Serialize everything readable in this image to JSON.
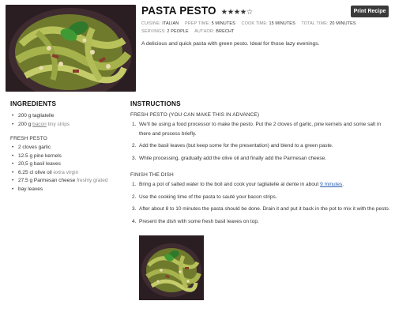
{
  "recipe": {
    "title": "PASTA PESTO",
    "stars": "★★★★☆",
    "print_label": "Print Recipe",
    "meta": {
      "cuisine_label": "CUISINE:",
      "cuisine": "ITALIAN",
      "prep_label": "PREP TIME:",
      "prep": "5 MINUTES",
      "cook_label": "COOK TIME:",
      "cook": "15 MINUTES",
      "total_label": "TOTAL TIME:",
      "total": "20 MINUTES",
      "servings_label": "SERVINGS:",
      "servings": "2 PEOPLE",
      "author_label": "AUTHOR:",
      "author": "BRECHT"
    },
    "description": "A delicious and quick pasta with green pesto. Ideal for those lazy evenings.",
    "hero_image": "pasta-pesto-photo",
    "dish_image": "pasta-pesto-photo"
  },
  "ingredients": {
    "heading": "INGREDIENTS",
    "main": [
      {
        "text": "200 g tagliatelle"
      },
      {
        "pre": "200 g ",
        "link": "bacon",
        "note": " tiny strips"
      }
    ],
    "pesto_heading": "FRESH PESTO",
    "pesto": [
      {
        "text": "2 cloves garlic"
      },
      {
        "text": "12.5 g pine kernels"
      },
      {
        "text": "20,5 g basil leaves"
      },
      {
        "pre": "6.25 cl olive oil",
        "note": " extra virgin"
      },
      {
        "pre": "27.5 g Parmesan cheese",
        "note": " freshly grated"
      },
      {
        "text": "bay leaves"
      }
    ]
  },
  "instructions": {
    "heading": "INSTRUCTIONS",
    "pesto_heading": "FRESH PESTO (YOU CAN MAKE THIS IN ADVANCE)",
    "pesto_steps": [
      {
        "num": "1.",
        "text": "We'll be using a food processor to make the pesto. Put the 2 cloves of garlic, pine kernels and some salt in there and process briefly."
      },
      {
        "num": "2.",
        "text": "Add the basil leaves (but keep some for the presentation) and blend to a green paste."
      },
      {
        "num": "3.",
        "text": "While processing, gradually add the olive oil and finally add the Parmesan cheese."
      }
    ],
    "finish_heading": "FINISH THE DISH",
    "finish_steps": [
      {
        "num": "1.",
        "pre": "Bring a pot of salted water to the boil and cook your tagliatelle al dente in about ",
        "link": "9 minutes",
        "post": "."
      },
      {
        "num": "2.",
        "text": "Use the cooking time of the pasta to sauté your bacon strips."
      },
      {
        "num": "3.",
        "text": "After about 8 to 10 minutes the pasta should be done. Drain it and put it back in the pot to mix it with the pesto."
      },
      {
        "num": "4.",
        "text": "Present the dish with some fresh basil leaves on top."
      }
    ]
  },
  "colors": {
    "print_button_bg": "#3a3a3a",
    "link": "#2a5db0",
    "muted": "#888888"
  }
}
